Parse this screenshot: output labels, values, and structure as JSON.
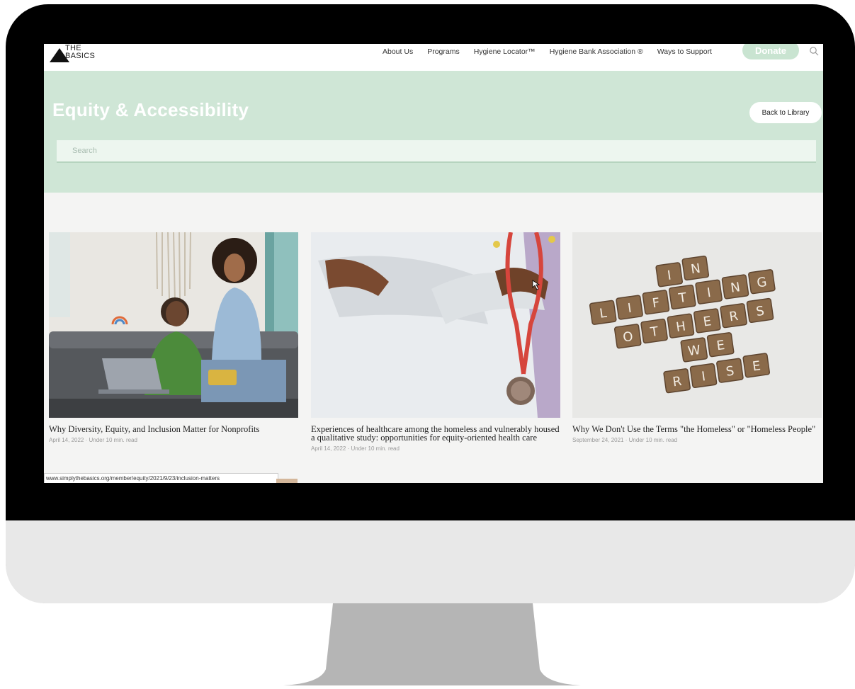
{
  "site": {
    "logo_line1": "THE",
    "logo_line2": "BASICS"
  },
  "nav": {
    "links": [
      "About Us",
      "Programs",
      "Hygiene Locator™",
      "Hygiene Bank Association ®",
      "Ways to Support"
    ],
    "donate_label": "Donate"
  },
  "hero": {
    "title": "Equity & Accessibility",
    "back_label": "Back to Library",
    "search_placeholder": "Search"
  },
  "cards": [
    {
      "title": "Why Diversity, Equity, and Inclusion Matter for Nonprofits",
      "meta": "April 14, 2022 · Under 10 min. read",
      "image": "two-women-laptop-image"
    },
    {
      "title": "Experiences of healthcare among the homeless and vulnerably housed a qualitative study: opportunities for equity-oriented health care",
      "meta": "April 14, 2022 · Under 10 min. read",
      "image": "doctor-stethoscope-image"
    },
    {
      "title": "Why We Don't Use the Terms \"the Homeless\" or \"Homeless People\"",
      "meta": "September 24, 2021 · Under 10 min. read",
      "image": "scrabble-tiles-image",
      "tiles": [
        "I",
        "N",
        "L",
        "I",
        "F",
        "T",
        "I",
        "N",
        "G",
        "O",
        "T",
        "H",
        "E",
        "R",
        "S",
        "W",
        "E",
        "R",
        "I",
        "S",
        "E"
      ]
    }
  ],
  "status_bar": {
    "url": "www.simplythebasics.org/member/equity/2021/9/23/inclusion-matters"
  },
  "colors": {
    "hero_bg": "#cfe6d6",
    "donate_bg": "#c9e4d1",
    "bezel": "#000000"
  }
}
